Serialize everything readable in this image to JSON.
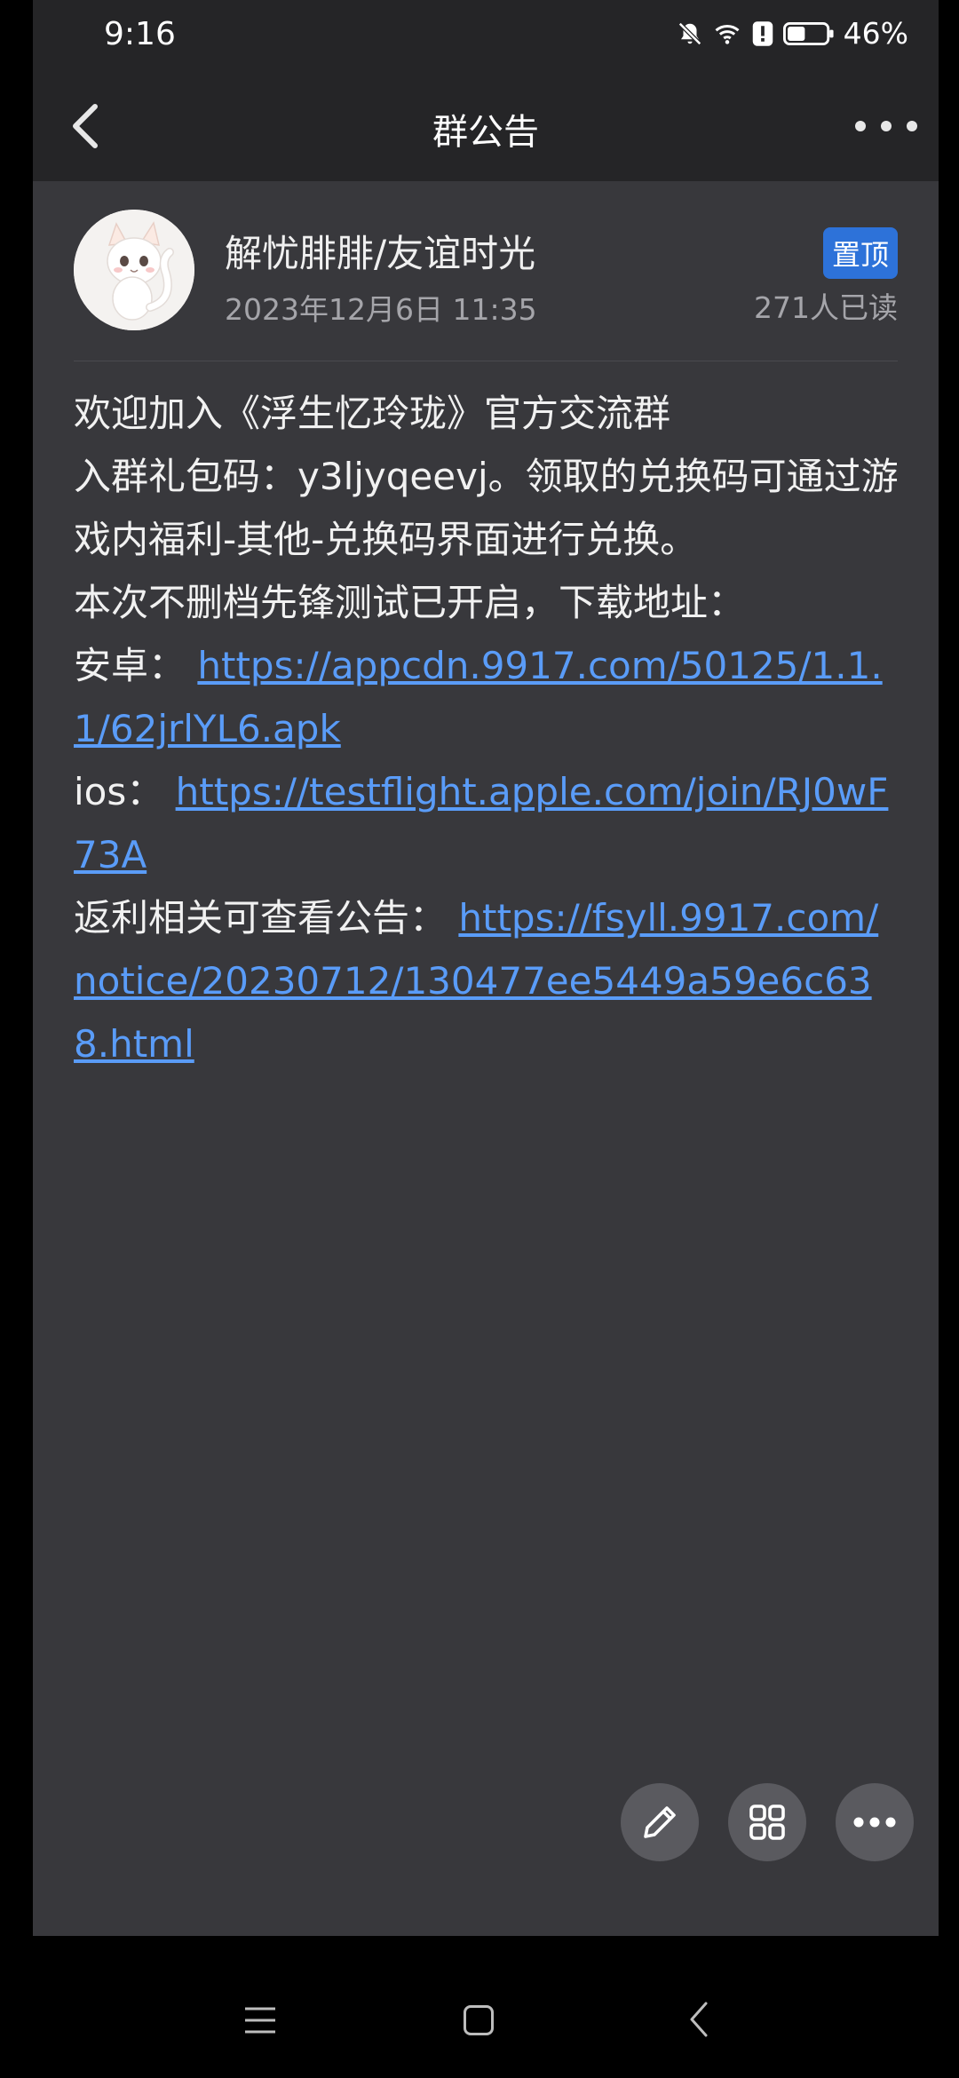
{
  "status_bar": {
    "time": "9:16",
    "battery_text": "46%",
    "battery_level": 0.46,
    "icons": [
      "bell-off-icon",
      "wifi-icon",
      "alert-icon",
      "battery-icon"
    ]
  },
  "nav": {
    "title": "群公告",
    "back_icon": "chevron-left-icon",
    "more_icon": "more-horizontal-icon"
  },
  "post": {
    "author": "解忧腓腓/友谊时光",
    "date": "2023年12月6日 11:35",
    "pin_badge": "置顶",
    "read_count": "271人已读",
    "lines": {
      "l1": "欢迎加入《浮生忆玲珑》官方交流群",
      "l2": "入群礼包码：y3ljyqeevj。领取的兑换码可通过游戏内福利-其他-兑换码界面进行兑换。",
      "l3": "本次不删档先锋测试已开启，下载地址：",
      "android_label": "安卓：",
      "android_link": "https://appcdn.9917.com/50125/1.1.1/62jrlYL6.apk",
      "ios_label": "ios：",
      "ios_link": "https://testflight.apple.com/join/RJ0wF73A",
      "notice_label": "返利相关可查看公告：",
      "notice_link": "https://fsyll.9917.com/notice/20230712/130477ee5449a59e6c638.html"
    }
  },
  "fabs": {
    "edit_icon": "pencil-icon",
    "grid_icon": "grid-icon",
    "more_icon": "more-horizontal-icon"
  },
  "system_nav": {
    "icons": [
      "menu-icon",
      "home-icon",
      "back-icon"
    ]
  },
  "colors": {
    "background": "#38383c",
    "header": "#252527",
    "accent": "#2d72d9",
    "link": "#5a9cf8"
  }
}
